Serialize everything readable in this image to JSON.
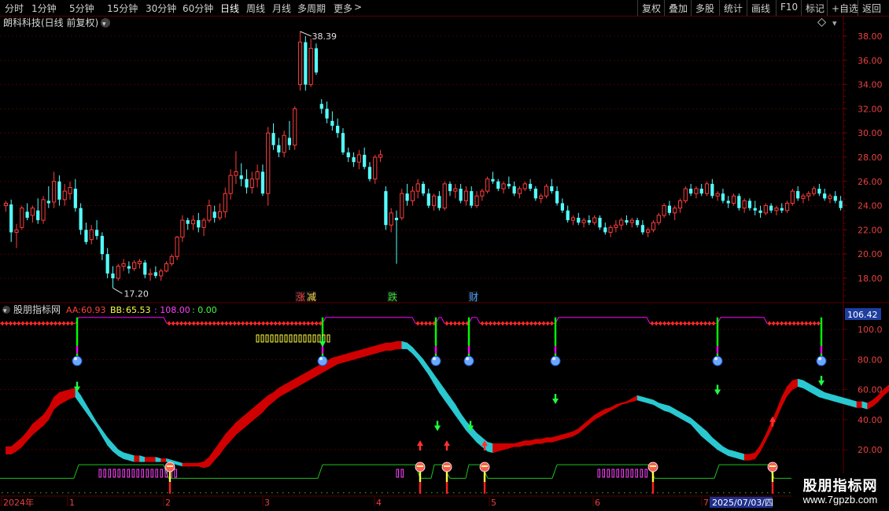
{
  "toolbar": {
    "left_items": [
      {
        "label": "分时",
        "x": 6
      },
      {
        "label": "1分钟",
        "x": 40
      },
      {
        "label": "5分钟",
        "x": 88
      },
      {
        "label": "15分钟",
        "x": 136
      },
      {
        "label": "30分钟",
        "x": 185
      },
      {
        "label": "60分钟",
        "x": 232
      },
      {
        "label": "日线",
        "x": 280,
        "active": true
      },
      {
        "label": "周线",
        "x": 313
      },
      {
        "label": "月线",
        "x": 346
      },
      {
        "label": "多周期",
        "x": 378
      },
      {
        "label": "更多",
        "x": 424
      }
    ],
    "more_chevron": ">",
    "right_items": [
      {
        "label": "复权",
        "x": 816
      },
      {
        "label": "叠加",
        "x": 850
      },
      {
        "label": "多股",
        "x": 884
      },
      {
        "label": "统计",
        "x": 920
      },
      {
        "label": "画线",
        "x": 955
      },
      {
        "label": "F10",
        "x": 992
      },
      {
        "label": "标记",
        "x": 1024
      },
      {
        "label": "+自选",
        "x": 1057
      },
      {
        "label": "返回",
        "x": 1096
      }
    ]
  },
  "main_panel": {
    "title": "朗科科技(日线 前复权)",
    "price_axis": [
      "38.00",
      "36.00",
      "34.00",
      "32.00",
      "30.00",
      "28.00",
      "26.00",
      "24.00",
      "22.00",
      "20.00",
      "18.00"
    ],
    "high_label": "38.39",
    "low_label": "17.20",
    "event_tags": [
      {
        "text": "涨",
        "color": "#ff4040"
      },
      {
        "text": "减",
        "color": "#ffd84a"
      },
      {
        "text": "跌",
        "color": "#38e038"
      },
      {
        "text": "财",
        "color": "#4aa0ff"
      }
    ]
  },
  "indicator_panel": {
    "name": "股朋指标网",
    "aa_label": "AA:",
    "aa_value": "60.93",
    "bb_label": "BB:",
    "bb_value": "65.53",
    "v3": ": 108.00",
    "v4": ": 0.00",
    "axis": [
      "100.0",
      "80.00",
      "60.00",
      "40.00",
      "20.00"
    ],
    "current_value": "106.42"
  },
  "x_axis": {
    "labels": [
      "2024年",
      "1",
      "2",
      "3",
      "4",
      "5",
      "6",
      "7"
    ],
    "cursor_date": "2025/07/03/四"
  },
  "watermark": {
    "title": "股朋指标网",
    "url": "www.7gpzb.com"
  },
  "colors": {
    "up": "#ff3c3c",
    "down": "#54ffff",
    "grid": "#5a0000",
    "axis_text": "#e84040",
    "band_up": "#d00000",
    "band_down": "#2ac8d0",
    "signal_green": "#00ff00",
    "signal_magenta": "#ff00ff"
  },
  "chart_data": {
    "type": "candlestick",
    "ylim": [
      16.8,
      39.2
    ],
    "high": 38.39,
    "low": 17.2,
    "candles": [
      [
        24.0,
        24.4,
        23.5,
        24.2
      ],
      [
        24.1,
        24.5,
        21.0,
        21.8
      ],
      [
        21.8,
        22.5,
        20.5,
        22.0
      ],
      [
        22.2,
        24.0,
        22.0,
        23.8
      ],
      [
        23.5,
        24.2,
        22.8,
        23.0
      ],
      [
        23.2,
        24.0,
        22.6,
        23.8
      ],
      [
        23.6,
        24.6,
        22.5,
        22.8
      ],
      [
        22.8,
        24.8,
        22.5,
        24.5
      ],
      [
        24.4,
        25.6,
        23.8,
        24.2
      ],
      [
        24.3,
        26.8,
        23.8,
        26.0
      ],
      [
        26.0,
        26.5,
        24.0,
        24.5
      ],
      [
        24.5,
        25.8,
        24.0,
        25.2
      ],
      [
        25.0,
        26.0,
        24.5,
        25.5
      ],
      [
        25.4,
        26.2,
        23.5,
        23.8
      ],
      [
        23.8,
        24.2,
        21.6,
        22.0
      ],
      [
        22.0,
        22.6,
        20.8,
        21.0
      ],
      [
        21.2,
        22.4,
        20.8,
        22.0
      ],
      [
        22.0,
        22.8,
        21.2,
        21.5
      ],
      [
        21.5,
        21.8,
        19.5,
        20.0
      ],
      [
        20.0,
        20.5,
        18.0,
        18.4
      ],
      [
        18.4,
        19.0,
        17.2,
        18.0
      ],
      [
        18.0,
        19.2,
        17.8,
        19.0
      ],
      [
        19.0,
        19.6,
        18.6,
        19.2
      ],
      [
        19.0,
        19.4,
        18.4,
        18.8
      ],
      [
        18.8,
        19.5,
        18.6,
        19.3
      ],
      [
        19.2,
        19.6,
        18.8,
        19.4
      ],
      [
        19.3,
        19.5,
        18.0,
        18.3
      ],
      [
        18.3,
        18.8,
        17.8,
        18.4
      ],
      [
        18.5,
        19.0,
        18.0,
        18.2
      ],
      [
        18.2,
        18.8,
        17.8,
        18.6
      ],
      [
        18.6,
        19.4,
        18.5,
        19.2
      ],
      [
        19.2,
        20.0,
        19.0,
        19.8
      ],
      [
        19.8,
        21.5,
        19.5,
        21.4
      ],
      [
        21.4,
        23.2,
        21.0,
        22.8
      ],
      [
        22.8,
        23.0,
        22.0,
        22.5
      ],
      [
        22.5,
        23.2,
        22.0,
        22.8
      ],
      [
        22.8,
        23.4,
        21.8,
        22.2
      ],
      [
        22.2,
        23.0,
        21.5,
        22.8
      ],
      [
        22.8,
        24.5,
        22.6,
        24.0
      ],
      [
        23.5,
        24.0,
        22.6,
        23.0
      ],
      [
        23.0,
        24.2,
        22.8,
        23.5
      ],
      [
        23.5,
        25.5,
        23.0,
        25.0
      ],
      [
        25.0,
        27.0,
        24.5,
        26.5
      ],
      [
        26.5,
        28.5,
        25.8,
        26.8
      ],
      [
        26.5,
        27.5,
        25.6,
        26.2
      ],
      [
        26.2,
        27.0,
        25.0,
        25.5
      ],
      [
        25.5,
        26.8,
        25.0,
        26.2
      ],
      [
        26.2,
        27.4,
        25.5,
        26.8
      ],
      [
        26.8,
        27.4,
        24.8,
        25.0
      ],
      [
        25.0,
        30.5,
        24.0,
        30.0
      ],
      [
        30.0,
        30.8,
        28.6,
        29.0
      ],
      [
        29.0,
        29.6,
        28.0,
        28.4
      ],
      [
        28.4,
        30.2,
        28.0,
        29.8
      ],
      [
        29.6,
        31.0,
        28.6,
        29.0
      ],
      [
        29.0,
        32.2,
        28.6,
        32.0
      ],
      [
        34.0,
        38.39,
        33.5,
        37.5
      ],
      [
        37.5,
        38.0,
        33.5,
        34.0
      ],
      [
        34.0,
        37.8,
        33.8,
        37.0
      ],
      [
        37.0,
        37.4,
        34.8,
        35.0
      ],
      [
        32.4,
        32.8,
        31.6,
        32.0
      ],
      [
        32.0,
        32.6,
        30.8,
        31.2
      ],
      [
        31.0,
        31.8,
        30.2,
        30.6
      ],
      [
        30.6,
        31.2,
        29.6,
        30.0
      ],
      [
        30.0,
        30.4,
        28.2,
        28.4
      ],
      [
        28.4,
        28.8,
        27.6,
        28.0
      ],
      [
        28.0,
        28.4,
        27.2,
        27.6
      ],
      [
        27.6,
        28.6,
        27.0,
        28.2
      ],
      [
        28.2,
        28.8,
        27.0,
        27.2
      ],
      [
        27.2,
        27.6,
        26.0,
        26.2
      ],
      [
        26.2,
        28.2,
        25.8,
        28.0
      ],
      [
        28.0,
        28.6,
        27.6,
        28.2
      ],
      [
        25.2,
        25.6,
        22.0,
        22.4
      ],
      [
        22.4,
        23.8,
        21.8,
        23.4
      ],
      [
        23.0,
        23.6,
        19.2,
        22.8
      ],
      [
        23.0,
        25.4,
        22.8,
        25.0
      ],
      [
        25.0,
        25.8,
        24.0,
        24.4
      ],
      [
        24.4,
        25.6,
        24.0,
        25.2
      ],
      [
        25.2,
        26.2,
        24.6,
        25.8
      ],
      [
        25.8,
        26.0,
        24.8,
        25.0
      ],
      [
        25.0,
        25.4,
        23.8,
        24.0
      ],
      [
        24.0,
        25.0,
        23.6,
        24.8
      ],
      [
        24.8,
        25.2,
        23.6,
        23.8
      ],
      [
        23.8,
        26.0,
        23.6,
        25.8
      ],
      [
        25.8,
        26.0,
        24.8,
        25.2
      ],
      [
        25.2,
        25.8,
        24.6,
        25.4
      ],
      [
        25.4,
        25.8,
        24.2,
        24.4
      ],
      [
        24.4,
        25.6,
        24.0,
        25.2
      ],
      [
        25.2,
        25.6,
        23.8,
        24.0
      ],
      [
        24.0,
        25.2,
        23.8,
        24.8
      ],
      [
        24.8,
        25.4,
        24.4,
        25.2
      ],
      [
        25.2,
        26.4,
        25.0,
        26.2
      ],
      [
        26.2,
        26.8,
        25.8,
        26.0
      ],
      [
        26.0,
        26.2,
        25.2,
        25.4
      ],
      [
        25.4,
        26.0,
        25.0,
        25.8
      ],
      [
        25.8,
        26.4,
        25.4,
        25.6
      ],
      [
        25.6,
        26.0,
        24.8,
        25.0
      ],
      [
        25.0,
        25.6,
        24.6,
        25.4
      ],
      [
        25.4,
        26.0,
        25.2,
        25.8
      ],
      [
        25.8,
        26.2,
        25.2,
        25.4
      ],
      [
        25.4,
        25.6,
        24.4,
        24.6
      ],
      [
        24.6,
        25.0,
        24.2,
        24.8
      ],
      [
        24.8,
        25.8,
        24.6,
        25.6
      ],
      [
        25.6,
        26.2,
        25.0,
        25.2
      ],
      [
        25.2,
        25.6,
        24.0,
        24.2
      ],
      [
        24.2,
        24.6,
        23.4,
        23.6
      ],
      [
        23.6,
        24.0,
        22.6,
        22.8
      ],
      [
        22.8,
        23.2,
        22.4,
        23.0
      ],
      [
        23.0,
        23.4,
        22.4,
        22.6
      ],
      [
        22.6,
        23.0,
        22.2,
        22.8
      ],
      [
        22.8,
        23.2,
        22.4,
        22.6
      ],
      [
        22.6,
        23.2,
        22.4,
        23.0
      ],
      [
        23.0,
        23.2,
        22.0,
        22.2
      ],
      [
        22.2,
        22.6,
        21.6,
        21.8
      ],
      [
        21.8,
        22.4,
        21.4,
        22.2
      ],
      [
        22.2,
        22.8,
        21.8,
        22.4
      ],
      [
        22.4,
        23.0,
        22.0,
        22.8
      ],
      [
        22.8,
        23.2,
        22.4,
        22.6
      ],
      [
        22.6,
        23.0,
        22.2,
        22.8
      ],
      [
        22.8,
        23.0,
        22.2,
        22.4
      ],
      [
        22.4,
        22.8,
        21.6,
        21.8
      ],
      [
        21.8,
        22.2,
        21.4,
        22.0
      ],
      [
        22.0,
        22.8,
        21.8,
        22.6
      ],
      [
        22.6,
        23.4,
        22.4,
        23.2
      ],
      [
        23.2,
        24.2,
        23.0,
        24.0
      ],
      [
        24.0,
        24.4,
        23.2,
        23.4
      ],
      [
        23.4,
        24.0,
        22.8,
        23.8
      ],
      [
        23.8,
        24.6,
        23.4,
        24.4
      ],
      [
        24.4,
        25.6,
        24.2,
        25.4
      ],
      [
        25.4,
        25.8,
        24.8,
        25.0
      ],
      [
        25.0,
        25.6,
        24.6,
        25.4
      ],
      [
        25.4,
        25.8,
        24.8,
        25.0
      ],
      [
        25.0,
        26.0,
        24.8,
        25.8
      ],
      [
        25.8,
        26.2,
        24.6,
        24.8
      ],
      [
        24.8,
        25.2,
        24.4,
        25.0
      ],
      [
        25.0,
        25.4,
        24.2,
        24.4
      ],
      [
        24.4,
        24.8,
        23.8,
        24.2
      ],
      [
        24.2,
        25.0,
        24.0,
        24.8
      ],
      [
        24.8,
        25.0,
        23.6,
        23.8
      ],
      [
        23.8,
        24.6,
        23.4,
        24.4
      ],
      [
        24.4,
        24.6,
        23.6,
        23.8
      ],
      [
        23.8,
        24.4,
        23.2,
        23.6
      ],
      [
        23.6,
        24.0,
        23.0,
        23.4
      ],
      [
        23.4,
        24.2,
        23.2,
        24.0
      ],
      [
        24.0,
        24.2,
        23.4,
        23.6
      ],
      [
        23.6,
        24.0,
        23.2,
        23.8
      ],
      [
        23.8,
        24.2,
        23.4,
        23.6
      ],
      [
        23.6,
        24.4,
        23.4,
        24.2
      ],
      [
        24.2,
        25.4,
        24.0,
        25.2
      ],
      [
        25.2,
        25.6,
        24.4,
        24.6
      ],
      [
        24.6,
        25.0,
        24.2,
        24.8
      ],
      [
        24.8,
        25.2,
        24.4,
        25.0
      ],
      [
        25.0,
        25.6,
        24.8,
        25.4
      ],
      [
        25.4,
        25.8,
        24.8,
        25.0
      ],
      [
        25.0,
        25.4,
        24.4,
        24.6
      ],
      [
        24.6,
        25.0,
        24.2,
        24.8
      ],
      [
        24.8,
        25.2,
        24.2,
        24.4
      ],
      [
        24.4,
        24.8,
        23.6,
        23.8
      ]
    ],
    "indicator": {
      "ylim": [
        0,
        112
      ],
      "upper": [
        22,
        22,
        25,
        28,
        32,
        37,
        40,
        43,
        48,
        55,
        58,
        59,
        60,
        61,
        56,
        50,
        44,
        38,
        33,
        28,
        24,
        20,
        18,
        17,
        16,
        16,
        15,
        15,
        15,
        14,
        14,
        13,
        12,
        11,
        11,
        11,
        11,
        12,
        15,
        20,
        25,
        30,
        34,
        38,
        41,
        44,
        47,
        50,
        53,
        56,
        58,
        61,
        63,
        65,
        67,
        69,
        71,
        73,
        75,
        77,
        79,
        81,
        82,
        83,
        84,
        85,
        86,
        87,
        88,
        89,
        90,
        91,
        91,
        92,
        92,
        91,
        88,
        84,
        80,
        75,
        70,
        65,
        60,
        55,
        50,
        44,
        39,
        35,
        31,
        28,
        25,
        24,
        24,
        24,
        24,
        24,
        25,
        26,
        26,
        27,
        27,
        28,
        28,
        29,
        30,
        31,
        32,
        34,
        37,
        40,
        43,
        45,
        47,
        48,
        50,
        51,
        52,
        54,
        56,
        55,
        54,
        53,
        51,
        50,
        49,
        47,
        45,
        43,
        41,
        38,
        35,
        32,
        28,
        25,
        22,
        20,
        19,
        18,
        17,
        17,
        18,
        23,
        30,
        38,
        46,
        55,
        62,
        66,
        67,
        66,
        64,
        62,
        60,
        58,
        57,
        56,
        55,
        54,
        53,
        52,
        52,
        51,
        53,
        56,
        60,
        63,
        65,
        67,
        69,
        70,
        71,
        71,
        69,
        67
      ],
      "lower": [
        17,
        17,
        19,
        22,
        26,
        30,
        33,
        36,
        40,
        47,
        50,
        52,
        54,
        55,
        50,
        45,
        40,
        35,
        29,
        23,
        19,
        16,
        14,
        13,
        12,
        12,
        12,
        12,
        12,
        12,
        12,
        11,
        10,
        9,
        9,
        9,
        9,
        8,
        9,
        13,
        17,
        22,
        26,
        30,
        33,
        36,
        39,
        42,
        45,
        49,
        52,
        55,
        57,
        59,
        61,
        63,
        65,
        67,
        69,
        71,
        73,
        75,
        77,
        78,
        79,
        80,
        81,
        82,
        83,
        84,
        85,
        86,
        86,
        87,
        87,
        87,
        84,
        80,
        75,
        70,
        64,
        58,
        53,
        48,
        43,
        38,
        33,
        29,
        25,
        22,
        19,
        18,
        19,
        20,
        21,
        22,
        22,
        23,
        23,
        24,
        24,
        25,
        25,
        26,
        27,
        28,
        29,
        31,
        34,
        37,
        40,
        42,
        44,
        46,
        48,
        50,
        51,
        52,
        53,
        52,
        51,
        50,
        48,
        46,
        45,
        43,
        41,
        39,
        37,
        33,
        29,
        26,
        23,
        20,
        18,
        16,
        15,
        14,
        13,
        13,
        14,
        19,
        26,
        33,
        41,
        49,
        56,
        60,
        62,
        61,
        59,
        57,
        55,
        54,
        53,
        52,
        51,
        50,
        49,
        48,
        48,
        47,
        49,
        52,
        56,
        59,
        61,
        63,
        65,
        67,
        68,
        68,
        66,
        63
      ]
    }
  }
}
